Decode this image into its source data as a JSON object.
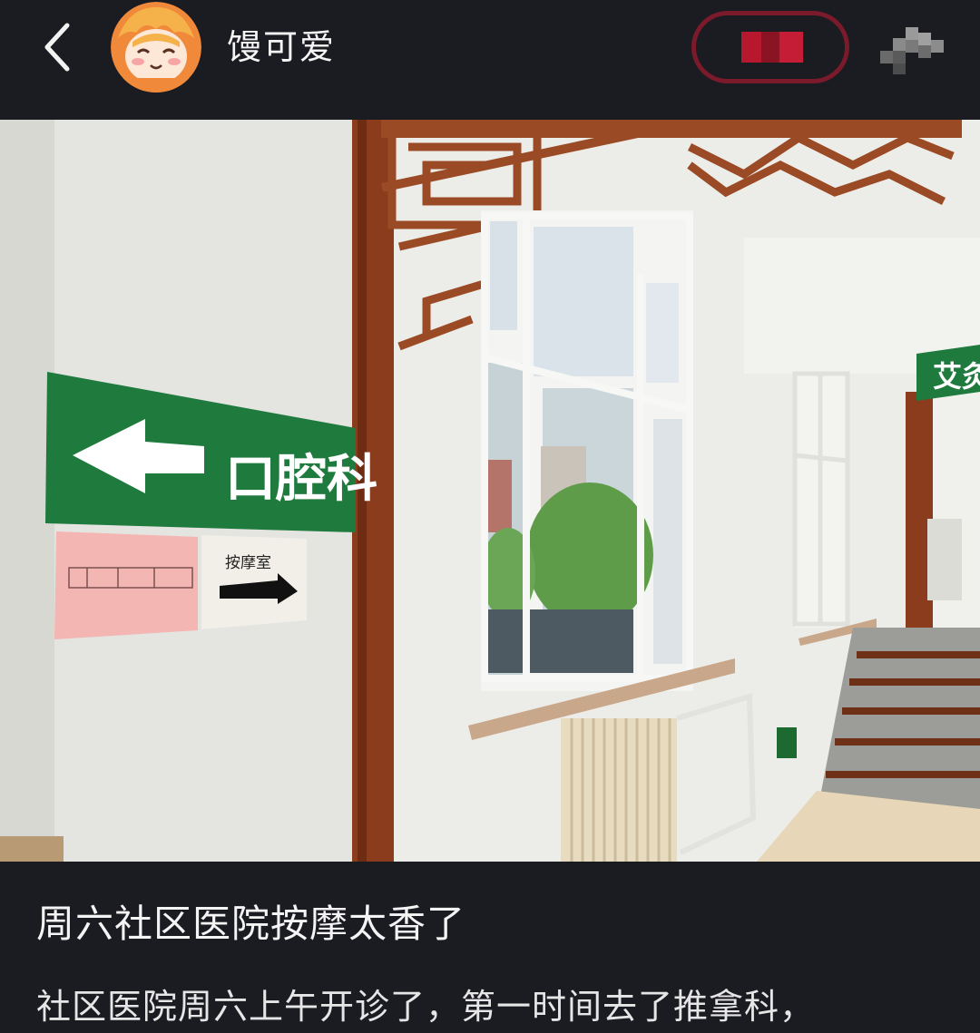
{
  "header": {
    "back_icon": "chevron-left-icon",
    "author_name": "馒可爱",
    "follow_label": "",
    "share_icon": "share-icon"
  },
  "photo": {
    "sign_main": "口腔科",
    "sign_sub": "按摩室",
    "sign_right": "艾灸"
  },
  "post": {
    "title": "周六社区医院按摩太香了",
    "body": "社区医院周六上午开诊了，第一时间去了推拿科，"
  },
  "colors": {
    "background": "#1b1b22",
    "sign_green": "#1f7a3e",
    "follow_border": "#7a1a2a"
  }
}
